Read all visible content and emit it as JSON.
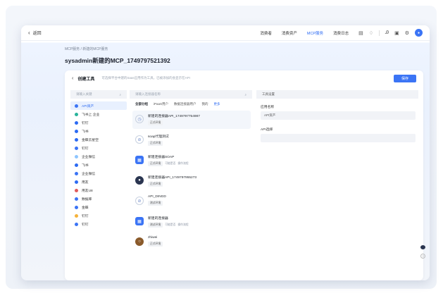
{
  "topbar": {
    "back_label": "返回",
    "nav": [
      "消费者",
      "消费资产",
      "MCP服务",
      "消费日志"
    ],
    "active_index": 2
  },
  "breadcrumb": "MCP服务 / 新建的MCP服务",
  "page_title": "sysadmin新建的MCP_1749797521392",
  "panel": {
    "title": "创建工具",
    "hint": "可选择平台中建的Saas应用作为工具，已被添加的会显示在API",
    "save_label": "保存"
  },
  "columns": {
    "left": "请输入关键",
    "middle": "请输入连接器名称",
    "right": "工具设置"
  },
  "left_items": [
    {
      "label": "API资产",
      "color": "#3b74f5"
    },
    {
      "label": "飞书上 企业",
      "color": "#29b39b"
    },
    {
      "label": "钉钉",
      "color": "#2b6af3"
    },
    {
      "label": "飞书",
      "color": "#2b6af3"
    },
    {
      "label": "金蝶云星空",
      "color": "#2b6af3"
    },
    {
      "label": "钉钉",
      "color": "#3b74f5"
    },
    {
      "label": "企业微信",
      "color": "#8ec5ff"
    },
    {
      "label": "飞书",
      "color": "#2b6af3"
    },
    {
      "label": "企业微信",
      "color": "#3b74f5"
    },
    {
      "label": "用友",
      "color": "#2b6af3"
    },
    {
      "label": "用友U8",
      "color": "#e05a5a"
    },
    {
      "label": "数据库",
      "color": "#3b74f5"
    },
    {
      "label": "金蝶",
      "color": "#3b74f5"
    },
    {
      "label": "钉钉",
      "color": "#f5b23b"
    },
    {
      "label": "钉钉",
      "color": "#3b74f5"
    }
  ],
  "tabs": [
    "全部分组",
    "iPaaS用户",
    "数据连接器用户",
    "我的",
    "更多"
  ],
  "middle_items": [
    {
      "name": "新建的连接器API_1749797754987",
      "icon": "clock-icon",
      "icon_text": "◷",
      "style": "",
      "tags": [
        "正式环境"
      ],
      "plain": []
    },
    {
      "name": "soap代理测试",
      "icon": "link-icon",
      "icon_text": "⊘",
      "style": "",
      "tags": [
        "正式环境"
      ],
      "plain": []
    },
    {
      "name": "新建连接器SOAP",
      "icon": "grid-icon",
      "icon_text": "▦",
      "style": "solid",
      "tags": [
        "正式环境"
      ],
      "plain": [
        "可能是否",
        "操作流程"
      ]
    },
    {
      "name": "新建连接器API_1749797955273",
      "icon": "drop-icon",
      "icon_text": "●",
      "style": "dark",
      "tags": [
        "正式环境"
      ],
      "plain": []
    },
    {
      "name": "API_DINGD",
      "icon": "link-icon",
      "icon_text": "⊘",
      "style": "",
      "tags": [
        "测试环境"
      ],
      "plain": []
    },
    {
      "name": "新建的连接器",
      "icon": "grid-icon",
      "icon_text": "▦",
      "style": "solid",
      "tags": [
        "测试环境"
      ],
      "plain": [
        "可能是否",
        "操作流程"
      ]
    },
    {
      "name": "zhiwei",
      "icon": "ring-icon",
      "icon_text": "○",
      "style": "brown",
      "tags": [
        "正式环境"
      ],
      "plain": []
    }
  ],
  "right": {
    "name_label": "应用名称",
    "name_value": "API资产",
    "api_label": "API选择",
    "api_value": ""
  }
}
